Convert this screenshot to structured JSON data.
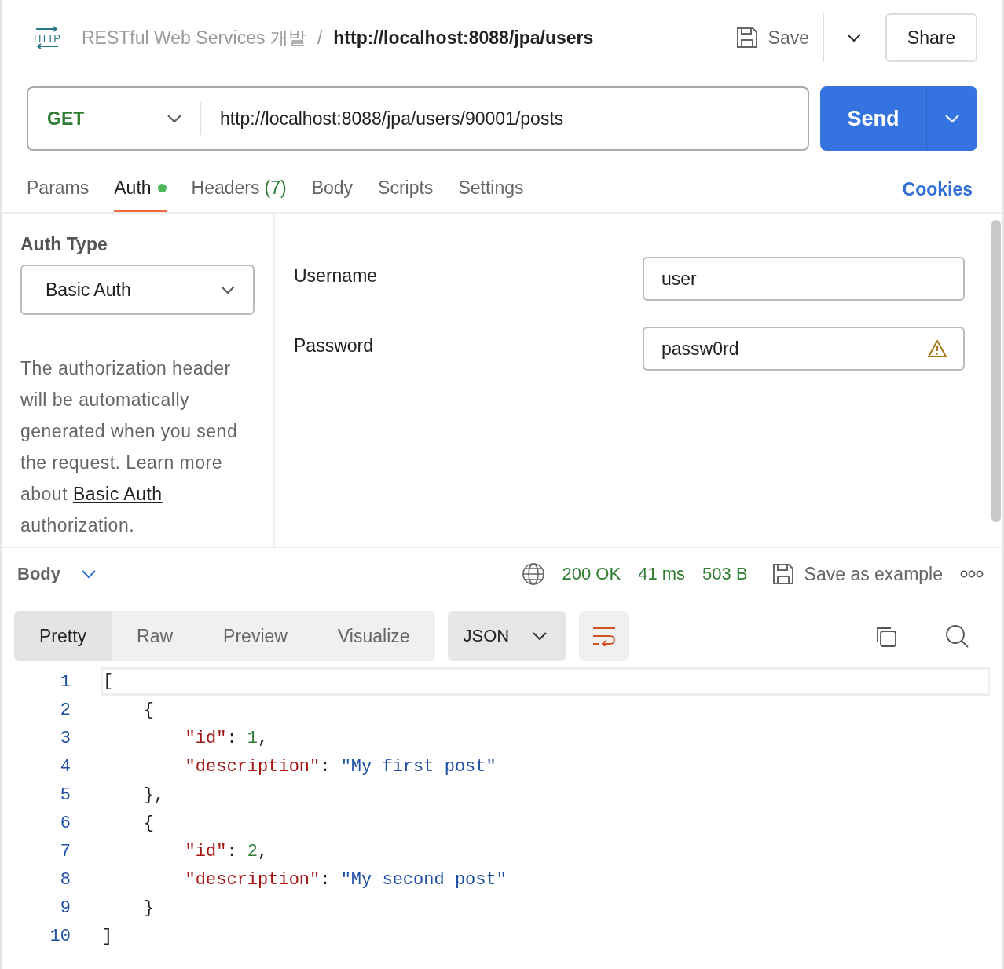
{
  "header": {
    "logo_text": "HTTP",
    "collection": "RESTful Web Services 개발",
    "separator": "/",
    "request_name": "http://localhost:8088/jpa/users",
    "save_label": "Save",
    "share_label": "Share"
  },
  "request": {
    "method": "GET",
    "url": "http://localhost:8088/jpa/users/90001/posts",
    "send_label": "Send"
  },
  "tabs": [
    {
      "label": "Params",
      "selected": false
    },
    {
      "label": "Auth",
      "selected": true,
      "dot": true
    },
    {
      "label": "Headers",
      "count": "(7)",
      "selected": false
    },
    {
      "label": "Body",
      "selected": false
    },
    {
      "label": "Scripts",
      "selected": false
    },
    {
      "label": "Settings",
      "selected": false
    }
  ],
  "cookies_link": "Cookies",
  "auth": {
    "type_heading": "Auth Type",
    "type": "Basic Auth",
    "help_before": "The authorization header will be automatically generated when you send the request. Learn more about",
    "help_link": "Basic Auth",
    "help_after": "authorization.",
    "fields": [
      {
        "label": "Username",
        "value": "user",
        "warning": false
      },
      {
        "label": "Password",
        "value": "passw0rd",
        "warning": true
      }
    ]
  },
  "response": {
    "section": "Body",
    "status": "200 OK",
    "time": "41 ms",
    "size": "503 B",
    "save_example": "Save as example",
    "view_tabs": [
      {
        "label": "Pretty",
        "selected": true
      },
      {
        "label": "Raw",
        "selected": false
      },
      {
        "label": "Preview",
        "selected": false
      },
      {
        "label": "Visualize",
        "selected": false
      }
    ],
    "format": "JSON",
    "lines": [
      {
        "number": "1",
        "tokens": [
          {
            "text": "[",
            "kind": "punct"
          }
        ]
      },
      {
        "number": "2",
        "tokens": [
          {
            "text": "    {",
            "kind": "punct"
          }
        ]
      },
      {
        "number": "3",
        "tokens": [
          {
            "text": "        \"id\"",
            "kind": "key"
          },
          {
            "text": ": ",
            "kind": "punct"
          },
          {
            "text": "1",
            "kind": "number"
          },
          {
            "text": ",",
            "kind": "punct"
          }
        ]
      },
      {
        "number": "4",
        "tokens": [
          {
            "text": "        \"description\"",
            "kind": "key"
          },
          {
            "text": ": ",
            "kind": "punct"
          },
          {
            "text": "\"My first post\"",
            "kind": "string"
          }
        ]
      },
      {
        "number": "5",
        "tokens": [
          {
            "text": "    },",
            "kind": "punct"
          }
        ]
      },
      {
        "number": "6",
        "tokens": [
          {
            "text": "    {",
            "kind": "punct"
          }
        ]
      },
      {
        "number": "7",
        "tokens": [
          {
            "text": "        \"id\"",
            "kind": "key"
          },
          {
            "text": ": ",
            "kind": "punct"
          },
          {
            "text": "2",
            "kind": "number"
          },
          {
            "text": ",",
            "kind": "punct"
          }
        ]
      },
      {
        "number": "8",
        "tokens": [
          {
            "text": "        \"description\"",
            "kind": "key"
          },
          {
            "text": ": ",
            "kind": "punct"
          },
          {
            "text": "\"My second post\"",
            "kind": "string"
          }
        ]
      },
      {
        "number": "9",
        "tokens": [
          {
            "text": "    }",
            "kind": "punct"
          }
        ]
      },
      {
        "number": "10",
        "tokens": [
          {
            "text": "]",
            "kind": "punct"
          }
        ]
      }
    ]
  }
}
